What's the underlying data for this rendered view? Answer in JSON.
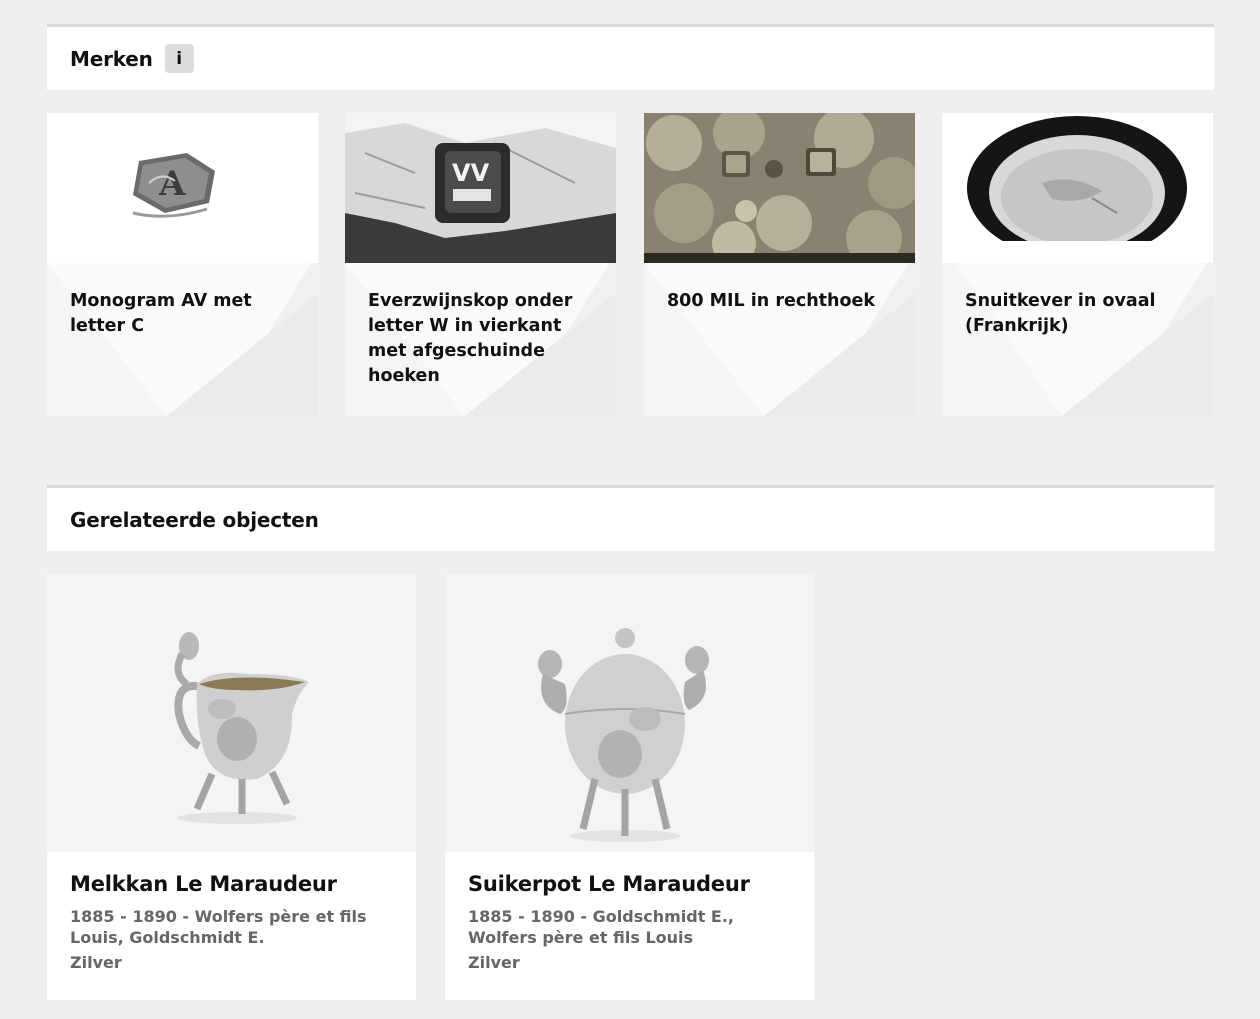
{
  "marks": {
    "title": "Merken",
    "info_label": "i",
    "items": [
      {
        "label": "Monogram AV met letter C"
      },
      {
        "label": "Everzwijnskop onder letter W in vierkant met afgeschuinde hoeken"
      },
      {
        "label": "800 MIL in rechthoek"
      },
      {
        "label": "Snuitkever in ovaal (Frankrijk)"
      }
    ]
  },
  "related": {
    "title": "Gerelateerde objecten",
    "items": [
      {
        "title": "Melkkan Le Maraudeur",
        "meta": "1885 - 1890 - Wolfers père et fils Louis, Goldschmidt E.",
        "material": "Zilver"
      },
      {
        "title": "Suikerpot Le Maraudeur",
        "meta": "1885 - 1890 - Goldschmidt E., Wolfers père et fils Louis",
        "material": "Zilver"
      }
    ]
  },
  "colors": {
    "page_background": "#efefef",
    "card_background": "#ffffff",
    "meta_text": "#666666"
  }
}
